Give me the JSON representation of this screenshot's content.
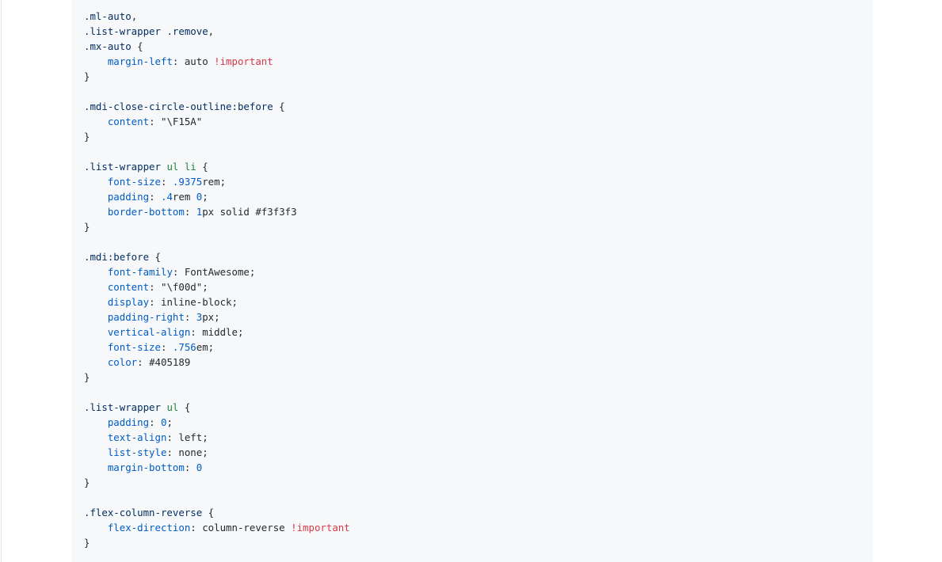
{
  "colors": {
    "default": "#24292e",
    "selector": "#032f62",
    "tag": "#22863a",
    "property": "#005cc5",
    "number": "#005cc5",
    "important": "#d73a49",
    "block_background": "#f6f8fa"
  },
  "code_block": {
    "language": "css",
    "lines": [
      [
        {
          "t": ".ml-auto",
          "c": "selector"
        },
        {
          "t": ",",
          "c": "default"
        }
      ],
      [
        {
          "t": ".list-wrapper",
          "c": "selector"
        },
        {
          "t": " ",
          "c": "default"
        },
        {
          "t": ".remove",
          "c": "selector"
        },
        {
          "t": ",",
          "c": "default"
        }
      ],
      [
        {
          "t": ".mx-auto",
          "c": "selector"
        },
        {
          "t": " {",
          "c": "default"
        }
      ],
      [
        {
          "t": "    ",
          "c": "default"
        },
        {
          "t": "margin-left",
          "c": "prop"
        },
        {
          "t": ": auto ",
          "c": "default"
        },
        {
          "t": "!important",
          "c": "important"
        }
      ],
      [
        {
          "t": "}",
          "c": "default"
        }
      ],
      [],
      [
        {
          "t": ".mdi-close-circle-outline:before",
          "c": "selector"
        },
        {
          "t": " {",
          "c": "default"
        }
      ],
      [
        {
          "t": "    ",
          "c": "default"
        },
        {
          "t": "content",
          "c": "prop"
        },
        {
          "t": ": \"\\F15A\"",
          "c": "default"
        }
      ],
      [
        {
          "t": "}",
          "c": "default"
        }
      ],
      [],
      [
        {
          "t": ".list-wrapper",
          "c": "selector"
        },
        {
          "t": " ",
          "c": "default"
        },
        {
          "t": "ul",
          "c": "tag"
        },
        {
          "t": " ",
          "c": "default"
        },
        {
          "t": "li",
          "c": "tag"
        },
        {
          "t": " {",
          "c": "default"
        }
      ],
      [
        {
          "t": "    ",
          "c": "default"
        },
        {
          "t": "font-size",
          "c": "prop"
        },
        {
          "t": ": ",
          "c": "default"
        },
        {
          "t": ".9375",
          "c": "number"
        },
        {
          "t": "rem;",
          "c": "default"
        }
      ],
      [
        {
          "t": "    ",
          "c": "default"
        },
        {
          "t": "padding",
          "c": "prop"
        },
        {
          "t": ": ",
          "c": "default"
        },
        {
          "t": ".4",
          "c": "number"
        },
        {
          "t": "rem ",
          "c": "default"
        },
        {
          "t": "0",
          "c": "number"
        },
        {
          "t": ";",
          "c": "default"
        }
      ],
      [
        {
          "t": "    ",
          "c": "default"
        },
        {
          "t": "border-bottom",
          "c": "prop"
        },
        {
          "t": ": ",
          "c": "default"
        },
        {
          "t": "1",
          "c": "number"
        },
        {
          "t": "px solid #f3f3f3",
          "c": "default"
        }
      ],
      [
        {
          "t": "}",
          "c": "default"
        }
      ],
      [],
      [
        {
          "t": ".mdi:before",
          "c": "selector"
        },
        {
          "t": " {",
          "c": "default"
        }
      ],
      [
        {
          "t": "    ",
          "c": "default"
        },
        {
          "t": "font-family",
          "c": "prop"
        },
        {
          "t": ": FontAwesome;",
          "c": "default"
        }
      ],
      [
        {
          "t": "    ",
          "c": "default"
        },
        {
          "t": "content",
          "c": "prop"
        },
        {
          "t": ": \"\\f00d\";",
          "c": "default"
        }
      ],
      [
        {
          "t": "    ",
          "c": "default"
        },
        {
          "t": "display",
          "c": "prop"
        },
        {
          "t": ": inline-block;",
          "c": "default"
        }
      ],
      [
        {
          "t": "    ",
          "c": "default"
        },
        {
          "t": "padding-right",
          "c": "prop"
        },
        {
          "t": ": ",
          "c": "default"
        },
        {
          "t": "3",
          "c": "number"
        },
        {
          "t": "px;",
          "c": "default"
        }
      ],
      [
        {
          "t": "    ",
          "c": "default"
        },
        {
          "t": "vertical-align",
          "c": "prop"
        },
        {
          "t": ": middle;",
          "c": "default"
        }
      ],
      [
        {
          "t": "    ",
          "c": "default"
        },
        {
          "t": "font-size",
          "c": "prop"
        },
        {
          "t": ": ",
          "c": "default"
        },
        {
          "t": ".756",
          "c": "number"
        },
        {
          "t": "em;",
          "c": "default"
        }
      ],
      [
        {
          "t": "    ",
          "c": "default"
        },
        {
          "t": "color",
          "c": "prop"
        },
        {
          "t": ": #405189",
          "c": "default"
        }
      ],
      [
        {
          "t": "}",
          "c": "default"
        }
      ],
      [],
      [
        {
          "t": ".list-wrapper",
          "c": "selector"
        },
        {
          "t": " ",
          "c": "default"
        },
        {
          "t": "ul",
          "c": "tag"
        },
        {
          "t": " {",
          "c": "default"
        }
      ],
      [
        {
          "t": "    ",
          "c": "default"
        },
        {
          "t": "padding",
          "c": "prop"
        },
        {
          "t": ": ",
          "c": "default"
        },
        {
          "t": "0",
          "c": "number"
        },
        {
          "t": ";",
          "c": "default"
        }
      ],
      [
        {
          "t": "    ",
          "c": "default"
        },
        {
          "t": "text-align",
          "c": "prop"
        },
        {
          "t": ": left;",
          "c": "default"
        }
      ],
      [
        {
          "t": "    ",
          "c": "default"
        },
        {
          "t": "list-style",
          "c": "prop"
        },
        {
          "t": ": none;",
          "c": "default"
        }
      ],
      [
        {
          "t": "    ",
          "c": "default"
        },
        {
          "t": "margin-bottom",
          "c": "prop"
        },
        {
          "t": ": ",
          "c": "default"
        },
        {
          "t": "0",
          "c": "number"
        }
      ],
      [
        {
          "t": "}",
          "c": "default"
        }
      ],
      [],
      [
        {
          "t": ".flex-column-reverse",
          "c": "selector"
        },
        {
          "t": " {",
          "c": "default"
        }
      ],
      [
        {
          "t": "    ",
          "c": "default"
        },
        {
          "t": "flex-direction",
          "c": "prop"
        },
        {
          "t": ": column-reverse ",
          "c": "default"
        },
        {
          "t": "!important",
          "c": "important"
        }
      ],
      [
        {
          "t": "}",
          "c": "default"
        }
      ]
    ]
  }
}
